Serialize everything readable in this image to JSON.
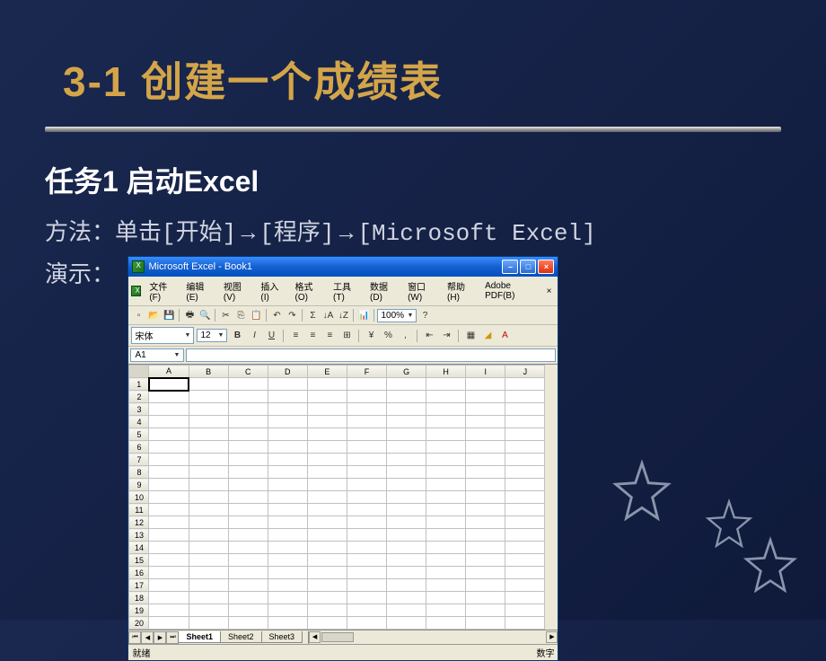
{
  "slide": {
    "title": "3-1 创建一个成绩表",
    "task_heading": "任务1  启动Excel",
    "method_label": "方法：",
    "method_text_1": "单击[开始]",
    "method_text_2": "[程序]",
    "method_text_3": "[Microsoft Excel]",
    "arrow": "→",
    "demo_label": "演示："
  },
  "excel": {
    "title": "Microsoft Excel - Book1",
    "menus": [
      "文件(F)",
      "编辑(E)",
      "视图(V)",
      "插入(I)",
      "格式(O)",
      "工具(T)",
      "数据(D)",
      "窗口(W)",
      "帮助(H)",
      "Adobe PDF(B)"
    ],
    "font_name": "宋体",
    "font_size": "12",
    "toolbar_percent": "100%",
    "active_cell": "A1",
    "columns": [
      "A",
      "B",
      "C",
      "D",
      "E",
      "F",
      "G",
      "H",
      "I",
      "J"
    ],
    "rows": [
      "1",
      "2",
      "3",
      "4",
      "5",
      "6",
      "7",
      "8",
      "9",
      "10",
      "11",
      "12",
      "13",
      "14",
      "15",
      "16",
      "17",
      "18",
      "19",
      "20"
    ],
    "sheets": [
      "Sheet1",
      "Sheet2",
      "Sheet3"
    ],
    "active_sheet": 0,
    "status_text": "就绪",
    "status_right": "数字"
  },
  "win_buttons": {
    "min": "–",
    "max": "□",
    "close": "×"
  }
}
